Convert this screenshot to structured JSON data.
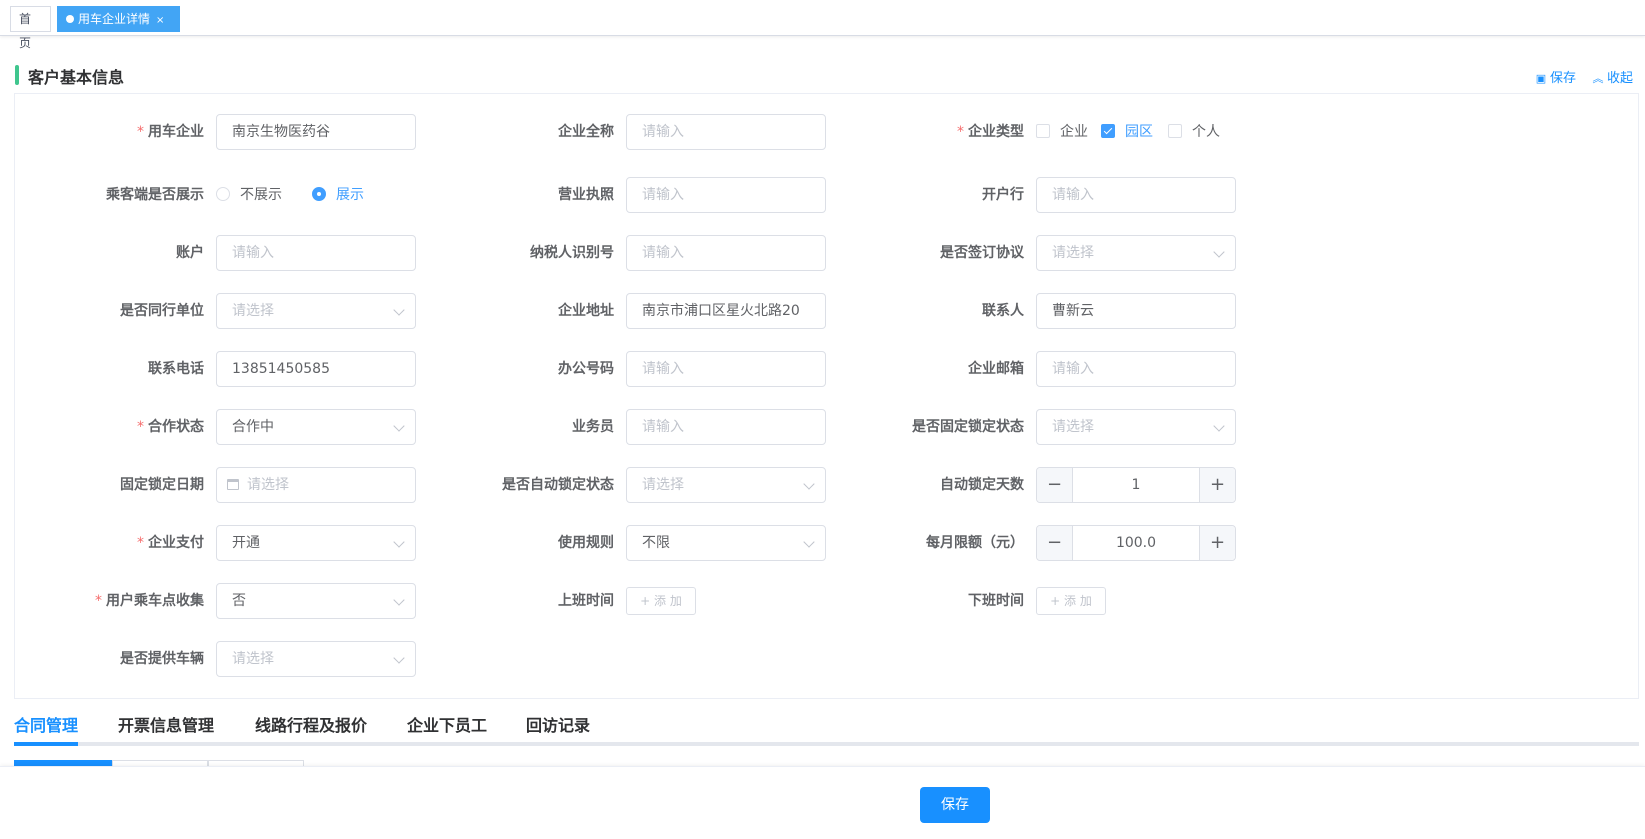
{
  "tags": {
    "home": "首页",
    "active": "用车企业详情",
    "close": "×"
  },
  "section": {
    "title": "客户基本信息",
    "save": "保存",
    "collapse": "收起"
  },
  "form": {
    "company": {
      "label": "用车企业",
      "value": "南京生物医药谷"
    },
    "fullname": {
      "label": "企业全称",
      "placeholder": "请输入"
    },
    "type": {
      "label": "企业类型",
      "options": [
        "企业",
        "园区",
        "个人"
      ],
      "checked": "园区"
    },
    "show": {
      "label": "乘客端是否展示",
      "options": [
        "不展示",
        "展示"
      ],
      "selected": "展示"
    },
    "license": {
      "label": "营业执照",
      "placeholder": "请输入"
    },
    "bank": {
      "label": "开户行",
      "placeholder": "请输入"
    },
    "account": {
      "label": "账户",
      "placeholder": "请输入"
    },
    "taxid": {
      "label": "纳税人识别号",
      "placeholder": "请输入"
    },
    "agreement": {
      "label": "是否签订协议",
      "placeholder": "请选择"
    },
    "peer": {
      "label": "是否同行单位",
      "placeholder": "请选择"
    },
    "address": {
      "label": "企业地址",
      "value": "南京市浦口区星火北路20"
    },
    "contact": {
      "label": "联系人",
      "value": "曹新云"
    },
    "phone": {
      "label": "联系电话",
      "value": "13851450585"
    },
    "office": {
      "label": "办公号码",
      "placeholder": "请输入"
    },
    "email": {
      "label": "企业邮箱",
      "placeholder": "请输入"
    },
    "coop": {
      "label": "合作状态",
      "value": "合作中"
    },
    "sales": {
      "label": "业务员",
      "placeholder": "请输入"
    },
    "fixlock": {
      "label": "是否固定锁定状态",
      "placeholder": "请选择"
    },
    "fixdate": {
      "label": "固定锁定日期",
      "placeholder": "请选择"
    },
    "autolock": {
      "label": "是否自动锁定状态",
      "placeholder": "请选择"
    },
    "autodays": {
      "label": "自动锁定天数",
      "value": "1"
    },
    "pay": {
      "label": "企业支付",
      "value": "开通"
    },
    "rule": {
      "label": "使用规则",
      "value": "不限"
    },
    "limit": {
      "label": "每月限额（元）",
      "value": "100.0"
    },
    "pickup": {
      "label": "用户乘车点收集",
      "value": "否"
    },
    "onwork": {
      "label": "上班时间",
      "add": "+ 添 加"
    },
    "offwork": {
      "label": "下班时间",
      "add": "+ 添 加"
    },
    "vehicle": {
      "label": "是否提供车辆",
      "placeholder": "请选择"
    }
  },
  "tabs": [
    "合同管理",
    "开票信息管理",
    "线路行程及报价",
    "企业下员工",
    "回访记录"
  ],
  "footer": {
    "save": "保存"
  },
  "colors": {
    "primary": "#1890ff",
    "accent": "#3fc68e",
    "required": "#f56c6c"
  }
}
